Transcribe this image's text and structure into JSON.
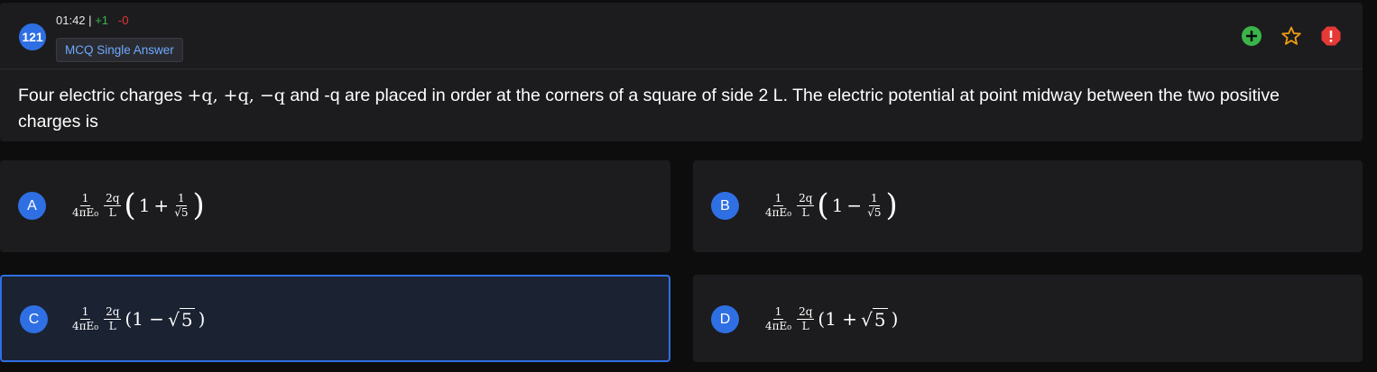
{
  "question": {
    "number": "121",
    "time": "01:42",
    "separator": "|",
    "marks_positive": "+1",
    "marks_negative": "-0",
    "type": "MCQ Single Answer",
    "text_part1": "Four electric charges ",
    "text_math": "+q, +q, −q",
    "text_part2": " and -q are placed in order at the corners of a square of side 2 L. The electric potential at point midway between the two positive charges is",
    "icons": {
      "add": "plus-circle-icon",
      "bookmark": "star-icon",
      "report": "alert-octagon-icon"
    },
    "colors": {
      "accent": "#2f6fe4",
      "add_green": "#3bb54a",
      "star_orange": "#f39c12",
      "report_red": "#e53935"
    }
  },
  "prefix": {
    "frac1_num": "1",
    "frac1_den": "4πE₀",
    "frac2_num": "2q",
    "frac2_den": "L"
  },
  "options": [
    {
      "letter": "A",
      "one": "1",
      "op": "+",
      "inner_num": "1",
      "inner_den": "√5",
      "selected": false
    },
    {
      "letter": "B",
      "one": "1",
      "op": "−",
      "inner_num": "1",
      "inner_den": "√5",
      "selected": false
    },
    {
      "letter": "C",
      "open": "(1 − ",
      "radicand": "5",
      "close": ")",
      "selected": true
    },
    {
      "letter": "D",
      "open": "(1 + ",
      "radicand": "5",
      "close": ")",
      "selected": false
    }
  ]
}
